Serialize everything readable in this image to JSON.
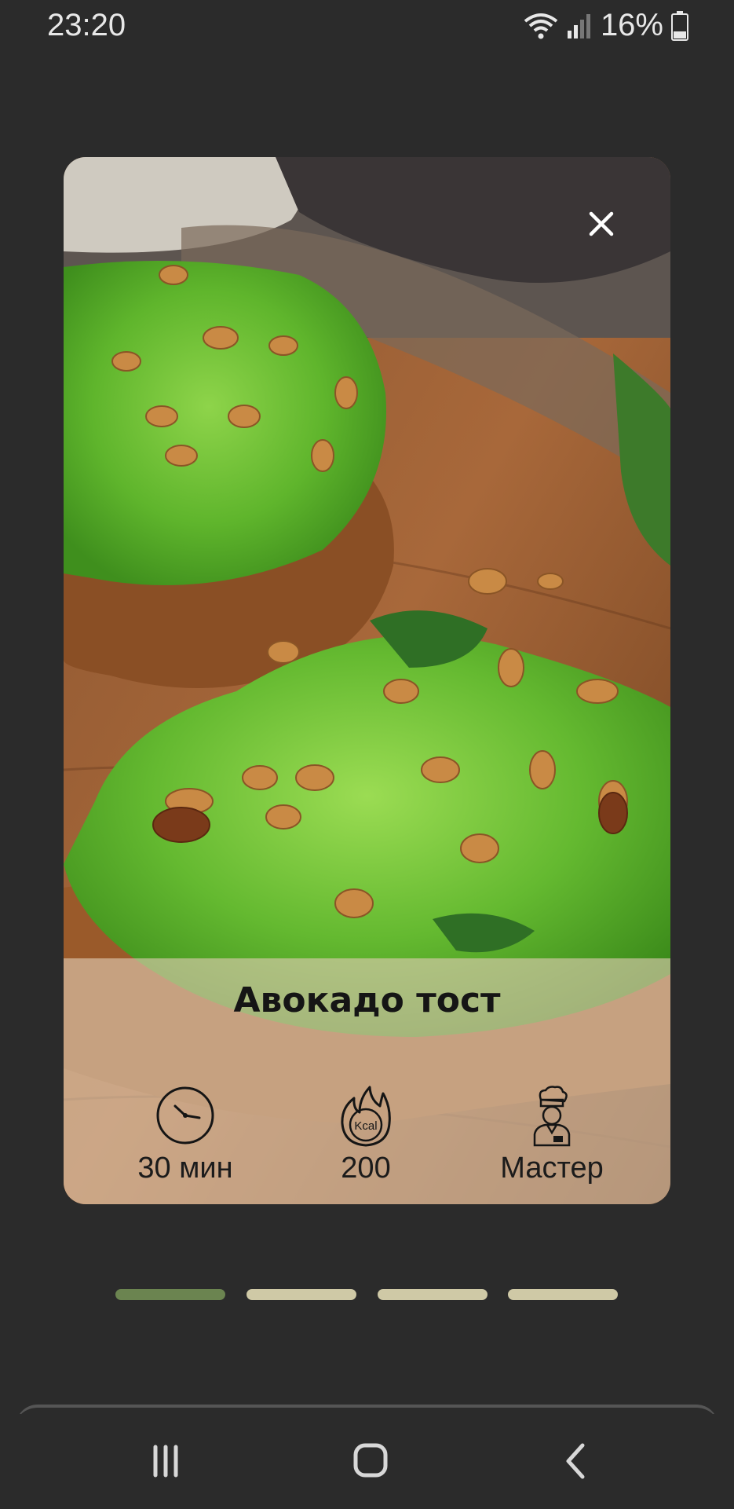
{
  "status_bar": {
    "time": "23:20",
    "battery_percent": "16%",
    "icons": [
      "wifi-icon",
      "signal-icon",
      "battery-icon"
    ]
  },
  "recipe_card": {
    "image": "avocado-toast-photo",
    "close_icon": "close-icon",
    "title": "Авокадо тост",
    "stats": [
      {
        "icon": "clock-icon",
        "label": "30 мин"
      },
      {
        "icon": "kcal-flame-icon",
        "label": "200"
      },
      {
        "icon": "chef-icon",
        "label": "Мастер"
      }
    ]
  },
  "pager": {
    "count": 4,
    "active_index": 0,
    "active_color": "#6b8450",
    "inactive_color": "#cfc9a6"
  },
  "nav_bar": {
    "items": [
      "recents-icon",
      "home-icon",
      "back-icon"
    ]
  }
}
